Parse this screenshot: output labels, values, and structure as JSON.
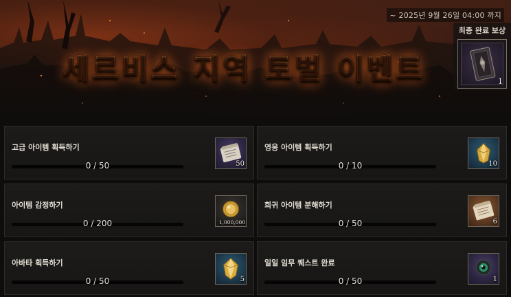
{
  "banner": {
    "title": "세르비스 지역 토벌 이벤트",
    "deadline": "~ 2025년 9월 26일 04:00 까지",
    "final_reward": {
      "label": "최종 완료 보상",
      "count": "1",
      "icon": "dark-card-icon"
    }
  },
  "missions": [
    {
      "title": "고급 아이템 획득하기",
      "progress": "0 / 50",
      "current": 0,
      "goal": 50,
      "reward_count": "50",
      "reward_icon": "scroll-icon",
      "slot_color": "purple"
    },
    {
      "title": "영웅 아이템 획득하기",
      "progress": "0 / 10",
      "current": 0,
      "goal": 10,
      "reward_count": "10",
      "reward_icon": "golden-gem-icon",
      "slot_color": "blue"
    },
    {
      "title": "아이템 감정하기",
      "progress": "0 / 200",
      "current": 0,
      "goal": 200,
      "reward_count": "1,000,000",
      "reward_icon": "gold-coin-icon",
      "slot_color": "gray"
    },
    {
      "title": "희귀 아이템 분해하기",
      "progress": "0 / 50",
      "current": 0,
      "goal": 50,
      "reward_count": "6",
      "reward_icon": "scroll-icon",
      "slot_color": "brown"
    },
    {
      "title": "아바타 획득하기",
      "progress": "0 / 50",
      "current": 0,
      "goal": 50,
      "reward_count": "5",
      "reward_icon": "golden-gem-icon",
      "slot_color": "blue"
    },
    {
      "title": "일일 임무 퀘스트 완료",
      "progress": "0 / 50",
      "current": 0,
      "goal": 50,
      "reward_count": "1",
      "reward_icon": "green-eye-orb-icon",
      "slot_color": "purple"
    }
  ]
}
